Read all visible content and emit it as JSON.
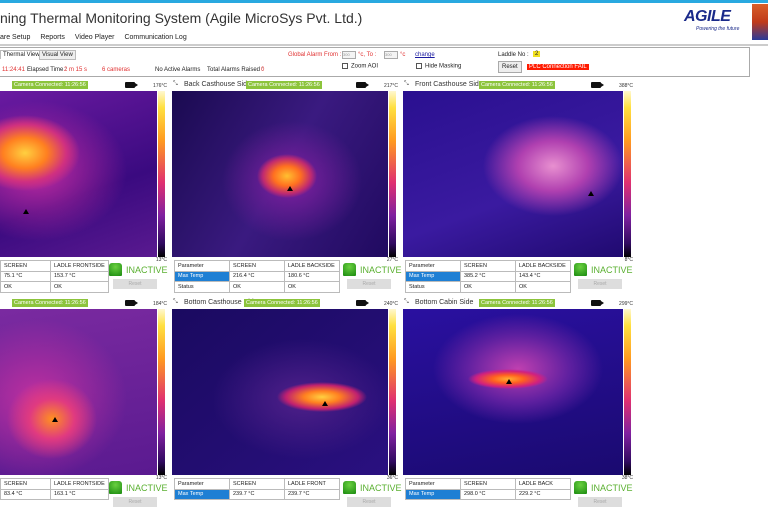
{
  "app": {
    "title": "ning Thermal Monitoring System (Agile MicroSys Pvt. Ltd.)",
    "logo_text": "AGILE",
    "logo_tagline": "Powering the future",
    "accent": "#29a9e0"
  },
  "menu": [
    "are Setup",
    "Reports",
    "Video Player",
    "Communication Log"
  ],
  "toolbar": {
    "tabs": [
      "Thermal View",
      "Visual View"
    ],
    "time": "11:24:41",
    "elapsed_label": "Elapsed Time :",
    "elapsed_value": "2 m 15 s",
    "cameras": "6 cameras",
    "alarms": "No Active Alarms",
    "total_alarms_label": "Total Alarms Raised :",
    "total_alarms_value": "0",
    "global_alarm_label": "Global Alarm From :",
    "alarm_from": "300",
    "to_label": "°c, To :",
    "alarm_to": "300",
    "unit": "°c",
    "change_link": "change",
    "zoom_aoi": "Zoom AOI",
    "hide_masking": "Hide Masking",
    "laddle_label": "Laddle No :",
    "laddle_value": "2",
    "reset": "Reset",
    "plc_status": "PLC Connection FAIL"
  },
  "panels": [
    {
      "name": "",
      "camera": "Camera Connected: 11:26:56",
      "max": "176°C",
      "min": "13°C",
      "cols": [
        "SCREEN",
        "LADLE FRONTSIDE"
      ],
      "rows": [
        [
          "75.1 °C",
          "153.7 °C"
        ],
        [
          "OK",
          "OK"
        ]
      ],
      "state": "INACTIVE",
      "reset": "Reset"
    },
    {
      "name": "Back Casthouse Side",
      "camera": "Camera Connected: 11:26:56",
      "max": "217°C",
      "min": "27°C",
      "cols": [
        "Parameter",
        "SCREEN",
        "LADLE BACKSIDE"
      ],
      "rows": [
        [
          "Max Temp",
          "216.4 °C",
          "180.6 °C"
        ],
        [
          "Status",
          "OK",
          "OK"
        ]
      ],
      "state": "INACTIVE",
      "reset": "Reset"
    },
    {
      "name": "Front Casthouse Side",
      "camera": "Camera Connected: 11:26:56",
      "max": "388°C",
      "min": "8°C",
      "cols": [
        "Parameter",
        "SCREEN",
        "LADLE BACKSIDE"
      ],
      "rows": [
        [
          "Max Temp",
          "385.2 °C",
          "143.4 °C"
        ],
        [
          "Status",
          "OK",
          "OK"
        ]
      ],
      "state": "INACTIVE",
      "reset": "Reset"
    },
    {
      "name": "",
      "camera": "Camera Connected: 11:26:56",
      "max": "184°C",
      "min": "13°C",
      "cols": [
        "SCREEN",
        "LADLE FRONTSIDE"
      ],
      "rows": [
        [
          "83.4 °C",
          "163.1 °C"
        ]
      ],
      "state": "INACTIVE",
      "reset": "Reset"
    },
    {
      "name": "Bottom Casthouse Sid",
      "camera": "Camera Connected: 11:26:56",
      "max": "240°C",
      "min": "36°C",
      "cols": [
        "Parameter",
        "SCREEN",
        "LADLE FRONT"
      ],
      "rows": [
        [
          "Max Temp",
          "239.7 °C",
          "239.7 °C"
        ]
      ],
      "state": "INACTIVE",
      "reset": "Reset"
    },
    {
      "name": "Bottom Cabin Side",
      "camera": "Camera Connected: 11:26:56",
      "max": "299°C",
      "min": "38°C",
      "cols": [
        "Parameter",
        "SCREEN",
        "LADLE BACK"
      ],
      "rows": [
        [
          "Max Temp",
          "298.0 °C",
          "229.2 °C"
        ]
      ],
      "state": "INACTIVE",
      "reset": "Reset"
    }
  ]
}
